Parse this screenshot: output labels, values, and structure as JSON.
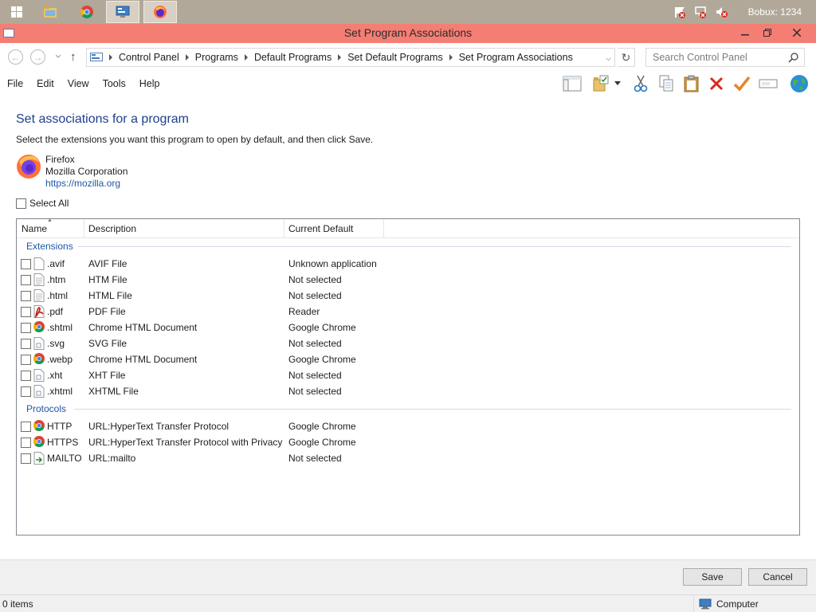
{
  "taskbar": {
    "user": "Bobux: 1234"
  },
  "window": {
    "title": "Set Program Associations"
  },
  "address": {
    "breadcrumbs": [
      "Control Panel",
      "Programs",
      "Default Programs",
      "Set Default Programs",
      "Set Program Associations"
    ],
    "search_placeholder": "Search Control Panel"
  },
  "menu": [
    "File",
    "Edit",
    "View",
    "Tools",
    "Help"
  ],
  "page": {
    "heading": "Set associations for a program",
    "instructions": "Select the extensions you want this program to open by default, and then click Save.",
    "program": {
      "name": "Firefox",
      "company": "Mozilla Corporation",
      "url": "https://mozilla.org"
    },
    "select_all": "Select All"
  },
  "list": {
    "columns": [
      "Name",
      "Description",
      "Current Default"
    ],
    "groups": [
      {
        "label": "Extensions",
        "rows": [
          {
            "name": ".avif",
            "description": "AVIF File",
            "current": "Unknown application",
            "icon": "blank-file-icon"
          },
          {
            "name": ".htm",
            "description": "HTM File",
            "current": "Not selected",
            "icon": "text-file-icon"
          },
          {
            "name": ".html",
            "description": "HTML File",
            "current": "Not selected",
            "icon": "text-file-icon"
          },
          {
            "name": ".pdf",
            "description": "PDF File",
            "current": "Reader",
            "icon": "pdf-file-icon"
          },
          {
            "name": ".shtml",
            "description": "Chrome HTML Document",
            "current": "Google Chrome",
            "icon": "chrome-icon"
          },
          {
            "name": ".svg",
            "description": "SVG File",
            "current": "Not selected",
            "icon": "svg-file-icon"
          },
          {
            "name": ".webp",
            "description": "Chrome HTML Document",
            "current": "Google Chrome",
            "icon": "chrome-icon"
          },
          {
            "name": ".xht",
            "description": "XHT File",
            "current": "Not selected",
            "icon": "svg-file-icon"
          },
          {
            "name": ".xhtml",
            "description": "XHTML File",
            "current": "Not selected",
            "icon": "svg-file-icon"
          }
        ]
      },
      {
        "label": "Protocols",
        "rows": [
          {
            "name": "HTTP",
            "description": "URL:HyperText Transfer Protocol",
            "current": "Google Chrome",
            "icon": "chrome-icon"
          },
          {
            "name": "HTTPS",
            "description": "URL:HyperText Transfer Protocol with Privacy",
            "current": "Google Chrome",
            "icon": "chrome-icon"
          },
          {
            "name": "MAILTO",
            "description": "URL:mailto",
            "current": "Not selected",
            "icon": "mailto-icon"
          }
        ]
      }
    ]
  },
  "buttons": {
    "save": "Save",
    "cancel": "Cancel"
  },
  "status": {
    "items": "0 items",
    "location": "Computer"
  },
  "colors": {
    "titlebar": "#f47e73",
    "taskbar": "#b2a89a",
    "heading": "#1e3f8c",
    "group": "#1e56a8"
  }
}
